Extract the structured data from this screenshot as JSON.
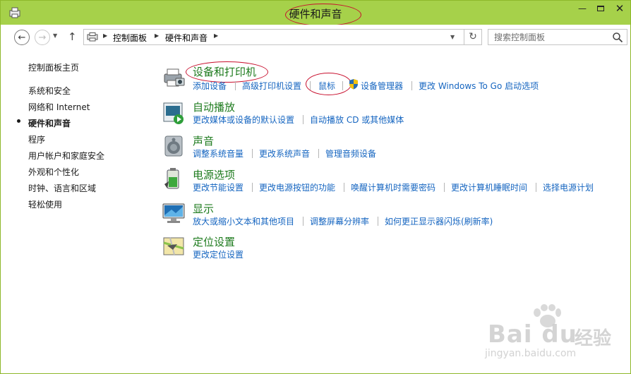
{
  "window": {
    "title": "硬件和声音",
    "minimize_label": "—",
    "close_label": "✕"
  },
  "nav": {
    "back_glyph": "←",
    "forward_glyph": "→",
    "up_glyph": "↑",
    "dropdown_glyph": "▼",
    "refresh_glyph": "↻"
  },
  "address": {
    "separator": "▶",
    "crumbs": [
      "控制面板",
      "硬件和声音"
    ]
  },
  "search": {
    "placeholder": "搜索控制面板"
  },
  "sidebar": {
    "items": [
      {
        "label": "控制面板主页"
      },
      {
        "label": "系统和安全"
      },
      {
        "label": "网络和 Internet"
      },
      {
        "label": "硬件和声音",
        "active": true
      },
      {
        "label": "程序"
      },
      {
        "label": "用户帐户和家庭安全"
      },
      {
        "label": "外观和个性化"
      },
      {
        "label": "时钟、语言和区域"
      },
      {
        "label": "轻松使用"
      }
    ]
  },
  "categories": [
    {
      "title": "设备和打印机",
      "icon": "printer-icon",
      "links": [
        "添加设备",
        "高级打印机设置",
        "鼠标",
        "设备管理器",
        "更改 Windows To Go 启动选项"
      ]
    },
    {
      "title": "自动播放",
      "icon": "autoplay-icon",
      "links": [
        "更改媒体或设备的默认设置",
        "自动播放 CD 或其他媒体"
      ]
    },
    {
      "title": "声音",
      "icon": "speaker-icon",
      "links": [
        "调整系统音量",
        "更改系统声音",
        "管理音频设备"
      ]
    },
    {
      "title": "电源选项",
      "icon": "battery-icon",
      "links": [
        "更改节能设置",
        "更改电源按钮的功能",
        "唤醒计算机时需要密码",
        "更改计算机睡眠时间",
        "选择电源计划"
      ]
    },
    {
      "title": "显示",
      "icon": "monitor-icon",
      "links": [
        "放大或缩小文本和其他项目",
        "调整屏幕分辨率",
        "如何更正显示器闪烁(刷新率)"
      ]
    },
    {
      "title": "定位设置",
      "icon": "location-icon",
      "links": [
        "更改定位设置"
      ]
    }
  ],
  "watermark": {
    "brand": "Bai du",
    "brand_cn": "经验",
    "url": "jingyan.baidu.com"
  },
  "colors": {
    "titlebar": "#a6d14a",
    "category_title": "#1e7b1e",
    "link": "#1565c0",
    "annotation": "#c8102e"
  }
}
